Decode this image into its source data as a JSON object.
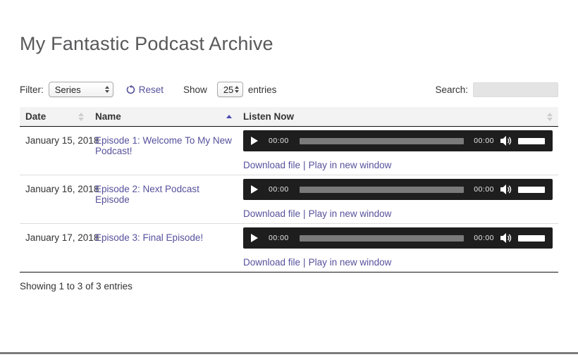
{
  "page": {
    "title": "My Fantastic Podcast Archive",
    "summary": "Showing 1 to 3 of 3 entries"
  },
  "controls": {
    "filter_label": "Filter:",
    "filter_value": "Series",
    "reset_label": "Reset",
    "show_label": "Show",
    "show_value": "25",
    "entries_label": "entries",
    "search_label": "Search:",
    "search_value": ""
  },
  "icons": {
    "reset": "circular-arrow",
    "select_spinner": "up-down-arrows",
    "sort": "up-down-triangles",
    "play": "play-triangle",
    "volume": "speaker-with-waves"
  },
  "colors": {
    "link": "#55519b",
    "active_sort_arrow": "#4a4ab2",
    "player_background": "#1e1e1e",
    "header_background": "#f3f3f3",
    "footer_bar": "#7c7c7c"
  },
  "table": {
    "headers": [
      {
        "label": "Date",
        "sort_state": "unsorted"
      },
      {
        "label": "Name",
        "sort_state": "ascending"
      },
      {
        "label": "Listen Now",
        "sort_state": "unsorted"
      }
    ],
    "row_links": {
      "download": "Download file",
      "divider": "|",
      "play_new_window": "Play in new window"
    },
    "rows": [
      {
        "date": "January 15, 2018",
        "name": "Episode 1: Welcome To My New Podcast!",
        "current_time": "00:00",
        "duration": "00:00"
      },
      {
        "date": "January 16, 2018",
        "name": "Episode 2: Next Podcast Episode",
        "current_time": "00:00",
        "duration": "00:00"
      },
      {
        "date": "January 17, 2018",
        "name": "Episode 3: Final Episode!",
        "current_time": "00:00",
        "duration": "00:00"
      }
    ]
  }
}
